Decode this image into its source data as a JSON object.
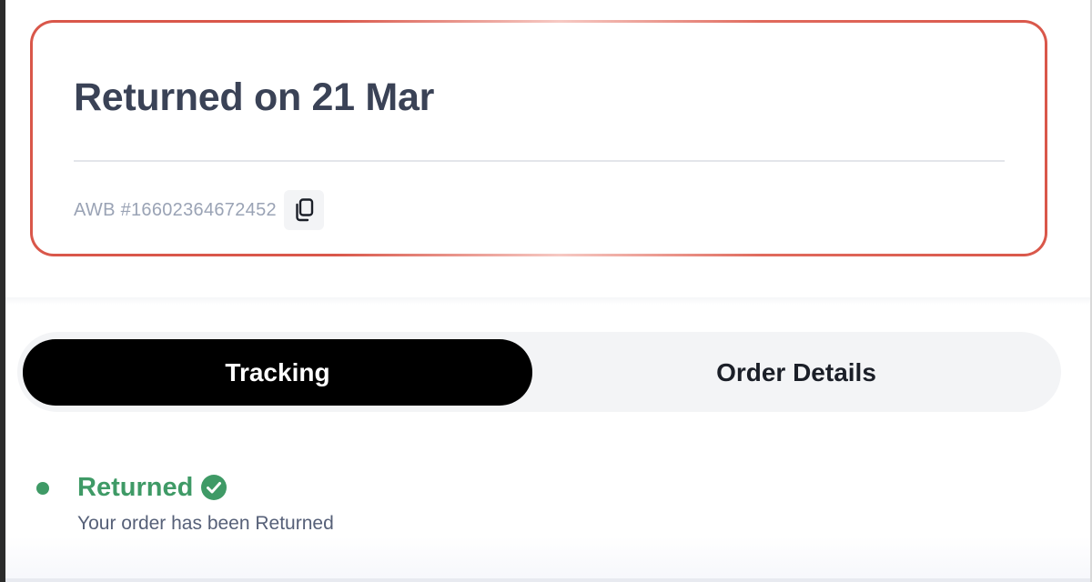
{
  "status_card": {
    "title": "Returned on 21 Mar",
    "awb": "AWB #16602364672452",
    "copy_icon": "copy-icon",
    "border_color": "#d9574a"
  },
  "tabs": [
    {
      "label": "Tracking",
      "active": true
    },
    {
      "label": "Order Details",
      "active": false
    }
  ],
  "timeline": {
    "events": [
      {
        "title": "Returned",
        "description": "Your order has been Returned",
        "status_icon": "check-circle-icon",
        "color": "#3f9a66"
      }
    ]
  }
}
